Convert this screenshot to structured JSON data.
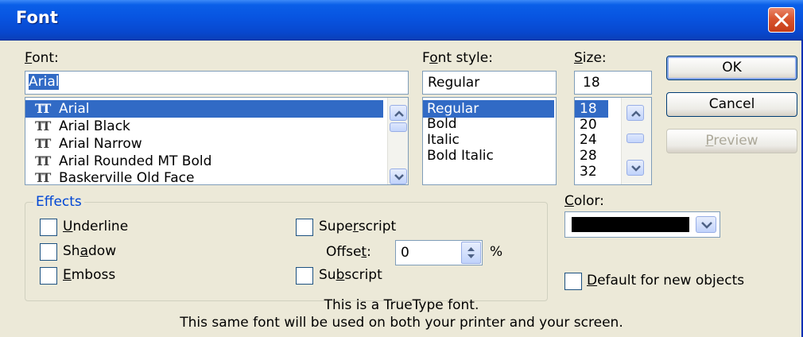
{
  "window": {
    "title": "Font"
  },
  "font": {
    "label": "Font:",
    "label_rest": "ont:",
    "label_key": "F",
    "value": "Arial",
    "items": [
      {
        "name": "Arial",
        "selected": true
      },
      {
        "name": "Arial Black",
        "selected": false
      },
      {
        "name": "Arial Narrow",
        "selected": false
      },
      {
        "name": "Arial Rounded MT Bold",
        "selected": false
      },
      {
        "name": "Baskerville Old Face",
        "selected": false
      }
    ],
    "icon": "truetype-icon"
  },
  "style": {
    "label_pre": "F",
    "label_key": "o",
    "label_rest": "nt style:",
    "value": "Regular",
    "items": [
      "Regular",
      "Bold",
      "Italic",
      "Bold Italic"
    ],
    "selected": "Regular"
  },
  "size": {
    "label_key": "S",
    "label_rest": "ize:",
    "value": "18",
    "items": [
      "18",
      "20",
      "24",
      "28",
      "32"
    ],
    "selected": "18"
  },
  "buttons": {
    "ok": "OK",
    "cancel": "Cancel",
    "preview_key": "P",
    "preview_rest": "review"
  },
  "effects": {
    "title": "Effects",
    "underline": {
      "key": "U",
      "rest": "nderline",
      "checked": false
    },
    "shadow": {
      "pre": "Sh",
      "key": "a",
      "rest": "dow",
      "checked": false
    },
    "emboss": {
      "key": "E",
      "rest": "mboss",
      "checked": false
    },
    "superscript": {
      "pre": "Supe",
      "key": "r",
      "rest": "script",
      "checked": false
    },
    "offset": {
      "pre": "Offse",
      "key": "t",
      "rest": ":",
      "value": "0",
      "unit": "%"
    },
    "subscript": {
      "pre": "Su",
      "key": "b",
      "rest": "script",
      "checked": false
    }
  },
  "color": {
    "label_key": "C",
    "label_rest": "olor:",
    "value": "#000000"
  },
  "default_new": {
    "key": "D",
    "rest": "efault for new objects",
    "checked": false
  },
  "info": {
    "line1": "This is a TrueType font.",
    "line2": "This same font will be used on both your printer and your screen."
  },
  "colors": {
    "title_bar": "#0854e0",
    "selection": "#316ac5",
    "close_button": "#d9552f",
    "effects_title": "#0046d5"
  }
}
